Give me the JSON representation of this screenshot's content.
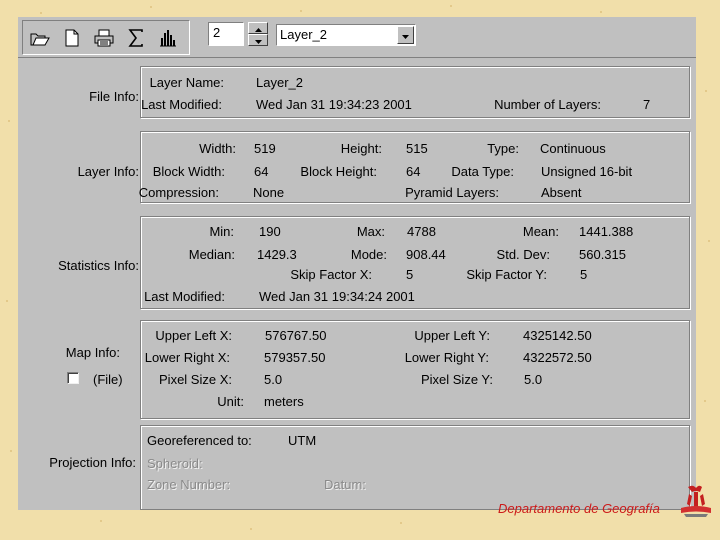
{
  "toolbar": {
    "icons": [
      "open-folder-icon",
      "new-document-icon",
      "print-icon",
      "sigma-icon",
      "histogram-icon"
    ],
    "band_spinner_value": "2",
    "layer_select_value": "Layer_2"
  },
  "file_info": {
    "section_label": "File Info:",
    "layer_name_label": "Layer Name:",
    "layer_name_value": "Layer_2",
    "last_modified_label": "Last Modified:",
    "last_modified_value": "Wed Jan 31 19:34:23 2001",
    "num_layers_label": "Number of Layers:",
    "num_layers_value": "7"
  },
  "layer_info": {
    "section_label": "Layer Info:",
    "width_label": "Width:",
    "width_value": "519",
    "height_label": "Height:",
    "height_value": "515",
    "type_label": "Type:",
    "type_value": "Continuous",
    "block_width_label": "Block Width:",
    "block_width_value": "64",
    "block_height_label": "Block Height:",
    "block_height_value": "64",
    "data_type_label": "Data Type:",
    "data_type_value": "Unsigned 16-bit",
    "compression_label": "Compression:",
    "compression_value": "None",
    "pyramid_label": "Pyramid Layers:",
    "pyramid_value": "Absent"
  },
  "statistics_info": {
    "section_label": "Statistics Info:",
    "min_label": "Min:",
    "min_value": "190",
    "max_label": "Max:",
    "max_value": "4788",
    "mean_label": "Mean:",
    "mean_value": "1441.388",
    "median_label": "Median:",
    "median_value": "1429.3",
    "mode_label": "Mode:",
    "mode_value": "908.44",
    "std_label": "Std. Dev:",
    "std_value": "560.315",
    "skip_x_label": "Skip Factor X:",
    "skip_x_value": "5",
    "skip_y_label": "Skip Factor Y:",
    "skip_y_value": "5",
    "last_modified_label": "Last Modified:",
    "last_modified_value": "Wed Jan 31 19:34:24 2001"
  },
  "map_info": {
    "section_label": "Map Info:",
    "file_checkbox_label": "(File)",
    "file_checkbox_checked": false,
    "upper_left_x_label": "Upper Left X:",
    "upper_left_x_value": "576767.50",
    "upper_left_y_label": "Upper Left Y:",
    "upper_left_y_value": "4325142.50",
    "lower_right_x_label": "Lower Right X:",
    "lower_right_x_value": "579357.50",
    "lower_right_y_label": "Lower Right Y:",
    "lower_right_y_value": "4322572.50",
    "pixel_size_x_label": "Pixel Size X:",
    "pixel_size_x_value": "5.0",
    "pixel_size_y_label": "Pixel Size Y:",
    "pixel_size_y_value": "5.0",
    "unit_label": "Unit:",
    "unit_value": "meters"
  },
  "projection_info": {
    "section_label": "Projection Info:",
    "georef_label": "Georeferenced to:",
    "georef_value": "UTM",
    "spheroid_label": "Spheroid:",
    "zone_label": "Zone Number:",
    "datum_label": "Datum:"
  },
  "footer": {
    "text": "Departamento de Geografía"
  },
  "colors": {
    "slide_background": "#f1dfaa",
    "window_background": "#c0c0c0",
    "footer_text": "#cc1a1a"
  }
}
